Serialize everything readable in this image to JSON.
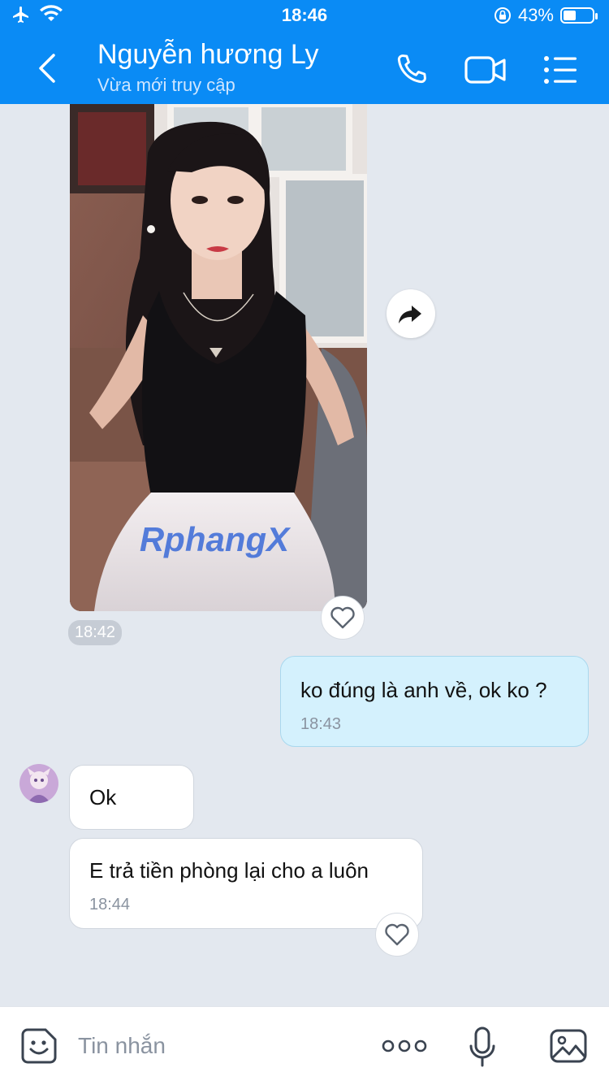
{
  "status_bar": {
    "time": "18:46",
    "battery": "43%",
    "battery_level": 0.43
  },
  "header": {
    "contact_name": "Nguyễn hương Ly",
    "presence": "Vừa mới truy cập"
  },
  "icons": {
    "back": "chevron-left-icon",
    "call": "phone-icon",
    "video": "video-camera-icon",
    "menu": "list-menu-icon",
    "share": "share-arrow-icon",
    "like": "heart-icon",
    "emoji": "emoji-sticker-icon",
    "more": "more-dots-icon",
    "mic": "microphone-icon",
    "image": "gallery-icon"
  },
  "messages": [
    {
      "sender": "them",
      "type": "image",
      "time": "18:42",
      "watermark": "RphangX"
    },
    {
      "sender": "me",
      "type": "text",
      "text": "ko đúng là anh về, ok ko ?",
      "time": "18:43"
    },
    {
      "sender": "them",
      "type": "text",
      "text": "Ok"
    },
    {
      "sender": "them",
      "type": "text",
      "text": "E trả tiền phòng lại cho a luôn",
      "time": "18:44"
    }
  ],
  "composer": {
    "placeholder": "Tin nhắn"
  },
  "colors": {
    "header": "#0a8bf5",
    "background": "#e3e8ef",
    "my_bubble": "#d4f1fd",
    "their_bubble": "#ffffff"
  }
}
